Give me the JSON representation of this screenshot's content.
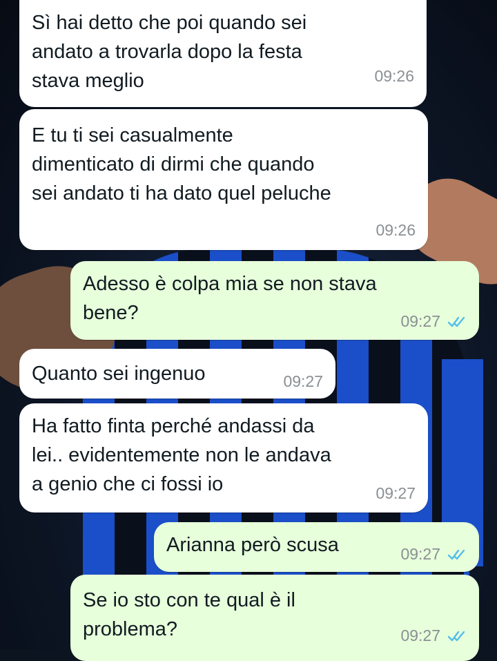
{
  "colors": {
    "incoming_bubble": "#ffffff",
    "outgoing_bubble": "#e7ffdb",
    "read_ticks": "#53bdeb",
    "timestamp": "#8a8f93"
  },
  "messages": [
    {
      "direction": "incoming",
      "text": "Sì hai detto che poi quando sei\nandato a trovarla dopo la festa\nstava meglio",
      "time": "09:26"
    },
    {
      "direction": "incoming",
      "text": "E tu ti sei casualmente\ndimenticato di dirmi che quando\nsei andato ti ha dato quel peluche",
      "time": "09:26"
    },
    {
      "direction": "outgoing",
      "text": "Adesso è colpa mia se non stava\nbene?",
      "time": "09:27",
      "status_icon": "double-check-read-icon"
    },
    {
      "direction": "incoming",
      "text": "Quanto sei ingenuo",
      "time": "09:27"
    },
    {
      "direction": "incoming",
      "text": "Ha fatto finta perché andassi da\nlei.. evidentemente non le andava\na genio che ci fossi io",
      "time": "09:27"
    },
    {
      "direction": "outgoing",
      "text": "Arianna però scusa",
      "time": "09:27",
      "status_icon": "double-check-read-icon"
    },
    {
      "direction": "outgoing",
      "text": "Se io sto con te qual è il\nproblema?",
      "time": "09:27",
      "status_icon": "double-check-read-icon"
    }
  ]
}
